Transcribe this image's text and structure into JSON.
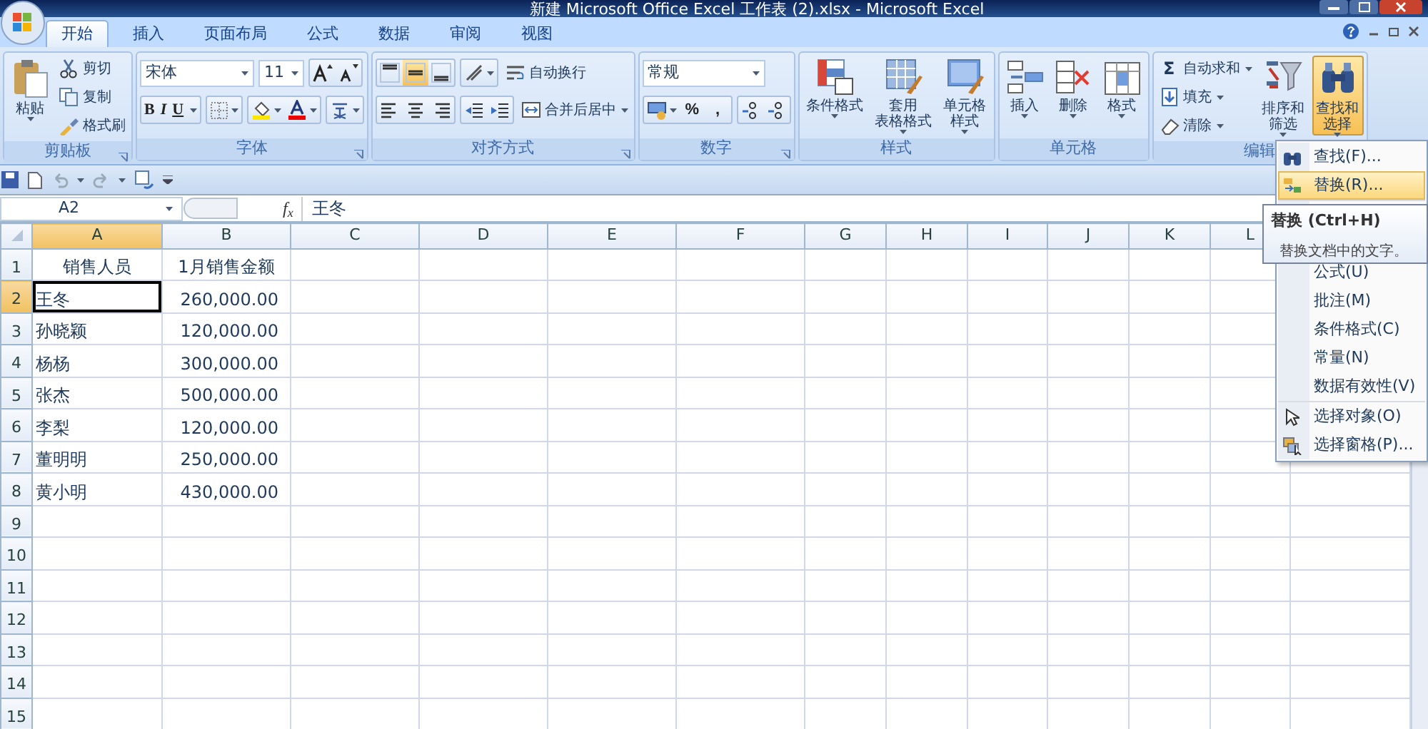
{
  "window": {
    "title": "新建 Microsoft Office Excel 工作表 (2).xlsx - Microsoft Excel"
  },
  "ribbon_tabs": [
    {
      "label": "开始",
      "selected": true
    },
    {
      "label": "插入",
      "selected": false
    },
    {
      "label": "页面布局",
      "selected": false
    },
    {
      "label": "公式",
      "selected": false
    },
    {
      "label": "数据",
      "selected": false
    },
    {
      "label": "审阅",
      "selected": false
    },
    {
      "label": "视图",
      "selected": false
    }
  ],
  "groups": [
    {
      "kind": "clipboard",
      "label": "剪贴板",
      "launcher": true,
      "large": [
        {
          "lines": [
            "粘贴"
          ]
        }
      ],
      "small": [
        {
          "label": "剪切"
        },
        {
          "label": "复制"
        },
        {
          "label": "格式刷"
        }
      ]
    },
    {
      "kind": "font",
      "label": "字体",
      "launcher": true,
      "font_name": "宋体",
      "font_size": "11",
      "styles": [
        "B",
        "I",
        "U"
      ]
    },
    {
      "kind": "alignment",
      "label": "对齐方式",
      "launcher": true,
      "align": [
        {
          "selected": false
        },
        {
          "selected": true
        },
        {
          "selected": false
        }
      ],
      "small": [
        {
          "label": "自动换行"
        },
        {
          "label": "合并后居中"
        }
      ]
    },
    {
      "kind": "number",
      "label": "数字",
      "launcher": true,
      "format": "常规",
      "symbols": [
        "%",
        ","
      ]
    },
    {
      "kind": "styles",
      "label": "样式",
      "launcher": false,
      "large": [
        {
          "lines": [
            "条件格式"
          ]
        },
        {
          "lines": [
            "套用",
            "表格格式"
          ]
        },
        {
          "lines": [
            "单元格",
            "样式"
          ]
        }
      ]
    },
    {
      "kind": "cells",
      "label": "单元格",
      "launcher": false,
      "large": [
        {
          "lines": [
            "插入"
          ]
        },
        {
          "lines": [
            "删除"
          ]
        },
        {
          "lines": [
            "格式"
          ]
        }
      ]
    },
    {
      "kind": "editing",
      "label": "编辑",
      "launcher": false,
      "small": [
        {
          "label": "自动求和",
          "symbol": "Σ"
        },
        {
          "label": "填充"
        },
        {
          "label": "清除"
        }
      ],
      "large": [
        {
          "lines": [
            "排序和",
            "筛选"
          ],
          "selected": false
        },
        {
          "lines": [
            "查找和",
            "选择"
          ],
          "selected": true
        }
      ]
    }
  ],
  "formula_bar": {
    "name_box": "A2",
    "function_label": "f$_{x}$",
    "content": "王冬"
  },
  "sheet": {
    "columns": [
      {
        "label": "A",
        "selected": true
      },
      {
        "label": "B",
        "selected": false
      },
      {
        "label": "C",
        "selected": false
      },
      {
        "label": "D",
        "selected": false
      },
      {
        "label": "E",
        "selected": false
      },
      {
        "label": "F",
        "selected": false
      },
      {
        "label": "G",
        "selected": false
      },
      {
        "label": "H",
        "selected": false
      },
      {
        "label": "I",
        "selected": false
      },
      {
        "label": "J",
        "selected": false
      },
      {
        "label": "K",
        "selected": false
      },
      {
        "label": "L",
        "selected": false
      }
    ],
    "rows": [
      {
        "label": "1",
        "selected": false,
        "kind": "header",
        "cells": [
          {
            "text": "销售人员",
            "selected": false
          },
          {
            "text": "1月销售金额",
            "selected": false
          }
        ]
      },
      {
        "label": "2",
        "selected": true,
        "kind": "data",
        "cells": [
          {
            "text": "王冬",
            "selected": true
          },
          {
            "text": "260,000.00",
            "selected": false
          }
        ]
      },
      {
        "label": "3",
        "selected": false,
        "kind": "data",
        "cells": [
          {
            "text": "孙晓颖",
            "selected": false
          },
          {
            "text": "120,000.00",
            "selected": false
          }
        ]
      },
      {
        "label": "4",
        "selected": false,
        "kind": "data",
        "cells": [
          {
            "text": "杨杨",
            "selected": false
          },
          {
            "text": "300,000.00",
            "selected": false
          }
        ]
      },
      {
        "label": "5",
        "selected": false,
        "kind": "data",
        "cells": [
          {
            "text": "张杰",
            "selected": false
          },
          {
            "text": "500,000.00",
            "selected": false
          }
        ]
      },
      {
        "label": "6",
        "selected": false,
        "kind": "data",
        "cells": [
          {
            "text": "李梨",
            "selected": false
          },
          {
            "text": "120,000.00",
            "selected": false
          }
        ]
      },
      {
        "label": "7",
        "selected": false,
        "kind": "data",
        "cells": [
          {
            "text": "董明明",
            "selected": false
          },
          {
            "text": "250,000.00",
            "selected": false
          }
        ]
      },
      {
        "label": "8",
        "selected": false,
        "kind": "data",
        "cells": [
          {
            "text": "黄小明",
            "selected": false
          },
          {
            "text": "430,000.00",
            "selected": false
          }
        ]
      },
      {
        "label": "9",
        "selected": false
      },
      {
        "label": "10",
        "selected": false
      },
      {
        "label": "11",
        "selected": false
      },
      {
        "label": "12",
        "selected": false
      },
      {
        "label": "13",
        "selected": false
      },
      {
        "label": "14",
        "selected": false
      },
      {
        "label": "15",
        "selected": false
      }
    ]
  },
  "menu": {
    "groups": [
      {
        "items": [
          {
            "label": "查找(F)...",
            "selected": false
          },
          {
            "label": "替换(R)...",
            "selected": true
          }
        ]
      },
      {
        "items": [
          {
            "label": "公式(U)",
            "selected": false
          },
          {
            "label": "批注(M)",
            "selected": false
          },
          {
            "label": "条件格式(C)",
            "selected": false
          },
          {
            "label": "常量(N)",
            "selected": false
          },
          {
            "label": "数据有效性(V)",
            "selected": false
          }
        ]
      },
      {
        "items": [
          {
            "label": "选择对象(O)",
            "selected": false
          },
          {
            "label": "选择窗格(P)...",
            "selected": false
          }
        ]
      }
    ]
  },
  "tooltip": {
    "title": "替换 (Ctrl+H)",
    "text": "替换文档中的文字。"
  }
}
